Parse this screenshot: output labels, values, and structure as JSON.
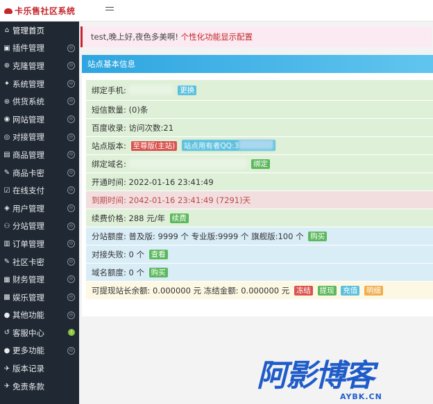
{
  "app": {
    "title": "卡乐售社区系统"
  },
  "sidebar": {
    "items": [
      {
        "label": "管理首页",
        "icon": "home-icon",
        "glyph": "⌂",
        "chev": ""
      },
      {
        "label": "插件管理",
        "icon": "lock-icon",
        "glyph": "▣",
        "chev": "⊖"
      },
      {
        "label": "克隆管理",
        "icon": "clone-icon",
        "glyph": "⊕",
        "chev": "⊖"
      },
      {
        "label": "系统管理",
        "icon": "gear-icon",
        "glyph": "✦",
        "chev": "⊖"
      },
      {
        "label": "供货系统",
        "icon": "supply-icon",
        "glyph": "⊛",
        "chev": "⊖"
      },
      {
        "label": "网站管理",
        "icon": "globe-icon",
        "glyph": "◉",
        "chev": "⊖"
      },
      {
        "label": "对接管理",
        "icon": "link-icon",
        "glyph": "◎",
        "chev": "⊖"
      },
      {
        "label": "商品管理",
        "icon": "box-icon",
        "glyph": "▤",
        "chev": "⊖"
      },
      {
        "label": "商品卡密",
        "icon": "key-icon",
        "glyph": "✎",
        "chev": "⊖"
      },
      {
        "label": "在线支付",
        "icon": "pay-icon",
        "glyph": "☑",
        "chev": "⊖"
      },
      {
        "label": "用户管理",
        "icon": "user-icon",
        "glyph": "◈",
        "chev": "⊖"
      },
      {
        "label": "分站管理",
        "icon": "sitemap-icon",
        "glyph": "⚇",
        "chev": "⊖"
      },
      {
        "label": "订单管理",
        "icon": "order-icon",
        "glyph": "▥",
        "chev": "⊖"
      },
      {
        "label": "社区卡密",
        "icon": "community-key-icon",
        "glyph": "✎",
        "chev": "⊖"
      },
      {
        "label": "财务管理",
        "icon": "finance-icon",
        "glyph": "▦",
        "chev": "⊖"
      },
      {
        "label": "娱乐管理",
        "icon": "game-icon",
        "glyph": "▩",
        "chev": "⊖"
      },
      {
        "label": "其他功能",
        "icon": "apple-icon",
        "glyph": "●",
        "chev": "⊖"
      },
      {
        "label": "客服中心",
        "icon": "support-icon",
        "glyph": "↺",
        "chev": "!"
      },
      {
        "label": "更多功能",
        "icon": "more-icon",
        "glyph": "●",
        "chev": "⊖"
      },
      {
        "label": "版本记录",
        "icon": "version-icon",
        "glyph": "✈",
        "chev": ""
      },
      {
        "label": "免责条款",
        "icon": "terms-icon",
        "glyph": "✈",
        "chev": ""
      }
    ]
  },
  "alert": {
    "greeting": "test,晚上好,夜色多美啊!",
    "link": "个性化功能显示配置"
  },
  "panel": {
    "title": "站点基本信息",
    "rows": {
      "phone": {
        "label": "绑定手机:",
        "btn": "更换"
      },
      "sms": {
        "label": "短信数量:",
        "value": "(0)条"
      },
      "baidu": {
        "label": "百度收录:",
        "value": "访问次数:21"
      },
      "version": {
        "label": "站点版本:",
        "tag": "至尊版(主站)",
        "extra": "站点用有者QQ:3"
      },
      "domain": {
        "label": "绑定域名:",
        "btn": "绑定"
      },
      "open": {
        "label": "开通时间:",
        "value": "2022-01-16 23:41:49"
      },
      "expire": {
        "label": "到期时间:",
        "value": "2042-01-16 23:41:49 (7291)天"
      },
      "price": {
        "label": "续费价格:",
        "value": "288 元/年",
        "btn": "续费"
      },
      "quota": {
        "label": "分站额度:",
        "value": "普及版: 9999 个 专业版:9999 个 旗舰版:100 个",
        "btn": "购买"
      },
      "fail": {
        "label": "对接失败:",
        "value": "0 个",
        "btn": "查看"
      },
      "dquota": {
        "label": "域名额度:",
        "value": "0 个",
        "btn": "购买"
      },
      "balance": {
        "value": "可提现站长余额: 0.000000 元 冻结金额: 0.000000 元",
        "b1": "冻结",
        "b2": "提现",
        "b3": "充值",
        "b4": "明细"
      }
    }
  },
  "watermark": {
    "text": "阿影博客",
    "sub": "AYBK.CN"
  },
  "colors": {
    "sidebar": "#1f2833",
    "brand": "#c5252b",
    "panel_head": "#2ea5e0"
  }
}
